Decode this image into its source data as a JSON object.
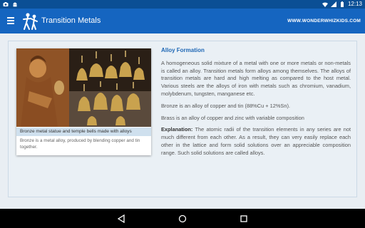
{
  "status": {
    "time": "12:13",
    "icons": [
      "camera-icon",
      "android-icon",
      "wifi-icon",
      "signal-icon",
      "battery-icon"
    ]
  },
  "appbar": {
    "title": "Transition Metals",
    "site": "WWW.WONDERWHIZKIDS.COM"
  },
  "figure": {
    "caption": "Bronze metal statue and temple bells made with alloys",
    "description": "Bronze is a metal alloy, produced by blending copper and tin together."
  },
  "article": {
    "heading": "Alloy Formation",
    "p1": "A homogeneous solid mixture of a metal with one or more metals or non-metals is called an alloy. Transition metals form alloys among themselves. The alloys of transition metals are hard and high melting as compared to the host metal. Various steels are the alloys of iron with metals such as chromium, vanadium, molybdenum, tungsten, manganese etc.",
    "p2": "Bronze is an alloy of copper and tin (88%Cu + 12%Sn).",
    "p3": "Brass is an alloy of copper and zinc with variable composition",
    "explanation_label": "Explanation:",
    "explanation": " The atomic radii of the transition elements in any series are not much different from each other. As a result, they can very easily replace each other in the lattice and form solid solutions over an appreciable composition range. Such solid solutions are called alloys."
  },
  "colors": {
    "appbar": "#1565c0",
    "statusbar": "#0b4f95",
    "heading": "#1e67b5"
  }
}
